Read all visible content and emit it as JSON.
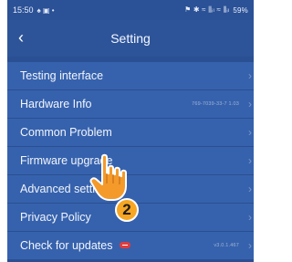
{
  "status_bar": {
    "time": "15:50",
    "left_icons": "♠ ▣ •",
    "right_icons": "⚑ ✱ ≈ ⫼ᵢₗ ≈ ⫼ᵢₗ",
    "battery": "59%"
  },
  "header": {
    "back_icon": "‹",
    "title": "Setting"
  },
  "menu": [
    {
      "label": "Testing interface",
      "value": ""
    },
    {
      "label": "Hardware Info",
      "value": "769-7039-33-7  1.03"
    },
    {
      "label": "Common Problem",
      "value": ""
    },
    {
      "label": "Firmware upgrade",
      "value": ""
    },
    {
      "label": "Advanced settings",
      "value": ""
    },
    {
      "label": "Privacy Policy",
      "value": ""
    },
    {
      "label": "Check for updates",
      "value": "v3.0.1.467"
    }
  ],
  "chevron": "›",
  "annotation": {
    "step_number": "2"
  },
  "colors": {
    "background": "#2a4f92",
    "row": "#3662ad",
    "step_badge": "#f6a623",
    "update_badge": "#e23b3b"
  }
}
